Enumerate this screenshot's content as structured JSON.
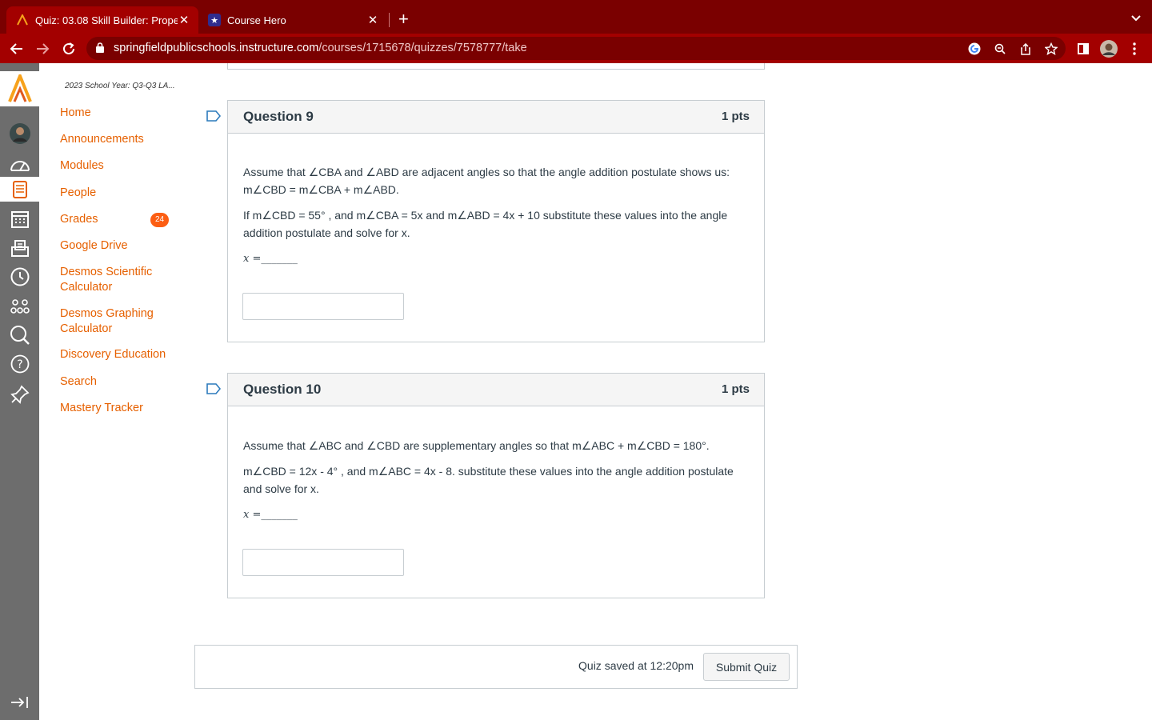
{
  "browser": {
    "tabs": [
      {
        "title": "Quiz: 03.08 Skill Builder: Prope",
        "active": true
      },
      {
        "title": "Course Hero",
        "active": false
      }
    ],
    "url_domain": "springfieldpublicschools.instructure.com",
    "url_path": "/courses/1715678/quizzes/7578777/take"
  },
  "course": {
    "breadcrumb": "2023 School Year: Q3-Q3 LA...",
    "nav": [
      {
        "label": "Home"
      },
      {
        "label": "Announcements"
      },
      {
        "label": "Modules"
      },
      {
        "label": "People"
      },
      {
        "label": "Grades",
        "badge": "24"
      },
      {
        "label": "Google Drive"
      },
      {
        "label": "Desmos Scientific Calculator"
      },
      {
        "label": "Desmos Graphing Calculator"
      },
      {
        "label": "Discovery Education"
      },
      {
        "label": "Search"
      },
      {
        "label": "Mastery Tracker"
      }
    ]
  },
  "questions": [
    {
      "title": "Question 9",
      "points": "1 pts",
      "text1": "Assume that ∠CBA and ∠ABD are adjacent angles so that the angle addition postulate shows us: m∠CBD = m∠CBA + m∠ABD.",
      "text2": "If m∠CBD = 55° , and m∠CBA = 5x and m∠ABD = 4x + 10 substitute these values into the angle addition postulate and solve for x.",
      "blank": "x =_______",
      "answer_value": ""
    },
    {
      "title": "Question 10",
      "points": "1 pts",
      "text1": "Assume that ∠ABC and ∠CBD are supplementary angles so that m∠ABC + m∠CBD = 180°.",
      "text2": "m∠CBD = 12x - 4° , and m∠ABC = 4x - 8. substitute these values into the angle addition postulate and solve for x.",
      "blank": "x =_______",
      "answer_value": ""
    }
  ],
  "footer": {
    "saved_text": "Quiz saved at 12:20pm",
    "submit_label": "Submit Quiz"
  },
  "colors": {
    "accent": "#e66000",
    "browser_frame": "#a30000",
    "global_nav": "#6d6d6d"
  }
}
